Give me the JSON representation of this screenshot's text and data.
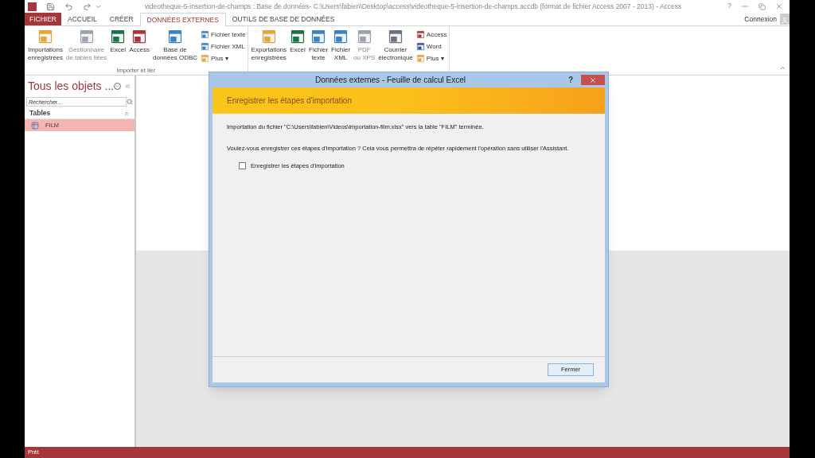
{
  "window": {
    "title": "videotheque-5-insertion-de-champs : Base de données- C:\\Users\\fabien\\Desktop\\access\\videotheque-5-insertion-de-champs.accdb (format de fichier Access 2007 - 2013) - Access",
    "help": "?",
    "account": "Connexion"
  },
  "tabs": [
    {
      "label": "FICHIER",
      "kind": "file",
      "selected": false
    },
    {
      "label": "ACCUEIL",
      "kind": "tab",
      "selected": false
    },
    {
      "label": "CRÉER",
      "kind": "tab",
      "selected": false
    },
    {
      "label": "DONNÉES EXTERNES",
      "kind": "tab",
      "selected": true
    },
    {
      "label": "OUTILS DE BASE DE DONNÉES",
      "kind": "tab",
      "selected": false
    }
  ],
  "ribbon": {
    "groups": [
      {
        "label": "Importer et lier",
        "large": [
          {
            "label": "Importations\nenregistrées",
            "kind": "import-saved",
            "disabled": false
          },
          {
            "label": "Gestionnaire\nde tables liées",
            "kind": "linked",
            "disabled": true
          },
          {
            "label": "Excel",
            "kind": "excel",
            "disabled": false
          },
          {
            "label": "Access",
            "kind": "access",
            "disabled": false
          },
          {
            "label": "Base de\ndonnées ODBC",
            "kind": "odbc",
            "disabled": false
          }
        ],
        "small": [
          {
            "label": "Fichier texte",
            "kind": "text"
          },
          {
            "label": "Fichier XML",
            "kind": "xml"
          },
          {
            "label": "Plus ▾",
            "kind": "more"
          }
        ]
      },
      {
        "large": [
          {
            "label": "Exportations\nenregistrées",
            "kind": "export-saved",
            "disabled": false
          },
          {
            "label": "Excel",
            "kind": "excel",
            "disabled": false
          },
          {
            "label": "Fichier\ntexte",
            "kind": "text",
            "disabled": false
          },
          {
            "label": "Fichier\nXML",
            "kind": "xml",
            "disabled": false
          },
          {
            "label": "PDF\nou XPS",
            "kind": "pdf",
            "disabled": true
          },
          {
            "label": "Courrier\nélectronique",
            "kind": "email",
            "disabled": false
          }
        ],
        "small": [
          {
            "label": "Access",
            "kind": "access"
          },
          {
            "label": "Word",
            "kind": "word"
          },
          {
            "label": "Plus ▾",
            "kind": "more"
          }
        ]
      }
    ]
  },
  "nav_pane": {
    "title": "Tous les objets ...",
    "search_placeholder": "Rechercher...",
    "groups": [
      {
        "label": "Tables",
        "items": [
          {
            "label": "FILM",
            "selected": true
          }
        ]
      }
    ]
  },
  "dialog": {
    "title": "Données externes - Feuille de calcul Excel",
    "help": "?",
    "banner": "Enregistrer les étapes d'importation",
    "messages": [
      "Importation du fichier \"C:\\Users\\fabien\\Videos\\importation-film.xlsx\" vers la table \"FILM\" terminée.",
      "Voulez-vous enregistrer ces étapes d'importation ? Cela vous permettra de répéter rapidement l'opération sans utiliser l'Assistant."
    ],
    "checkbox": {
      "label": "Enregistrer les étapes d'importation",
      "checked": false
    },
    "button": "Fermer"
  },
  "status_bar": {
    "text": "Prêt"
  }
}
